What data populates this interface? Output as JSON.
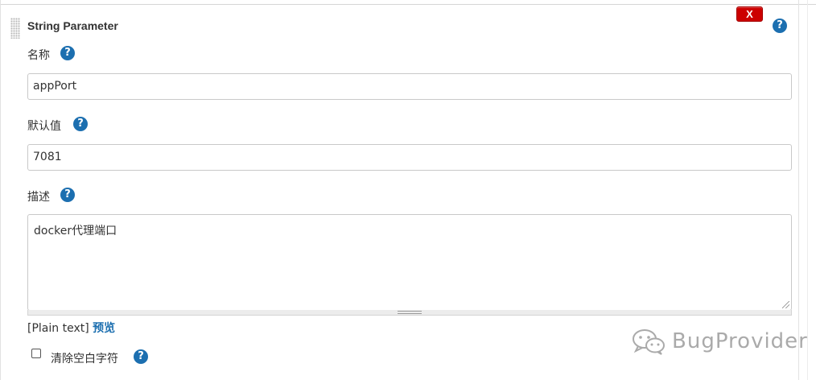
{
  "section": {
    "title": "String Parameter",
    "delete_label": "X",
    "help_glyph": "?"
  },
  "fields": {
    "name": {
      "label": "名称",
      "value": "appPort"
    },
    "default_value": {
      "label": "默认值",
      "value": "7081"
    },
    "description": {
      "label": "描述",
      "value": "docker代理端口"
    }
  },
  "format": {
    "mode": "[Plain text]",
    "preview_link": "预览"
  },
  "trim_option": {
    "label": "清除空白字符",
    "checked": false
  },
  "watermark": {
    "text": "BugProvider"
  },
  "colors": {
    "accent": "#1c6fb0",
    "delete": "#cc0000"
  },
  "icons": [
    "drag-handle-icon",
    "delete-icon",
    "help-icon",
    "checkbox-icon",
    "wechat-logo-icon"
  ]
}
